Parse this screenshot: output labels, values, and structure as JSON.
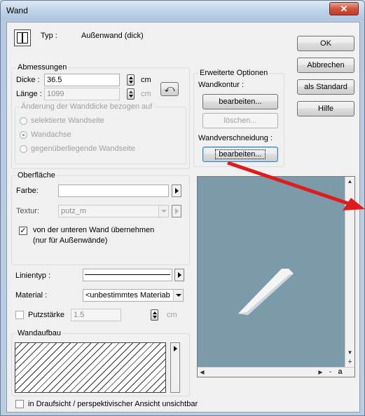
{
  "window": {
    "title": "Wand",
    "close_symbol": "✕"
  },
  "typ": {
    "label": "Typ :",
    "value": "Außenwand (dick)"
  },
  "buttons": {
    "ok": "OK",
    "abbrechen": "Abbrechen",
    "als_standard": "als Standard",
    "hilfe": "Hilfe"
  },
  "abmessungen": {
    "legend": "Abmessungen",
    "dicke_label": "Dicke :",
    "dicke_value": "36.5",
    "dicke_unit": "cm",
    "laenge_label": "Länge :",
    "laenge_value": "1099",
    "laenge_unit": "cm",
    "subgroup_legend": "Änderung der Wanddicke bezogen auf",
    "radio_options": [
      {
        "label": "selektierte Wandseite",
        "checked": false
      },
      {
        "label": "Wandachse",
        "checked": true
      },
      {
        "label": "gegenüberliegende Wandseite",
        "checked": false
      }
    ]
  },
  "erweiterte_optionen": {
    "legend": "Erweiterte Optionen",
    "wandkontur_label": "Wandkontur :",
    "bearbeiten_1": "bearbeiten...",
    "loeschen": "löschen...",
    "wandverschneidung_label": "Wandverschneidung :",
    "bearbeiten_2": "bearbeiten..."
  },
  "oberflaeche": {
    "legend": "Oberfläche",
    "farbe_label": "Farbe:",
    "textur_label": "Textur:",
    "textur_value": "putz_m",
    "checkbox_label_line1": "von der unteren Wand übernehmen",
    "checkbox_label_line2": "(nur für Außenwände)",
    "checkbox_checked": true
  },
  "linientyp": {
    "label": "Linientyp :"
  },
  "material": {
    "label": "Material :",
    "value": "<unbestimmtes Materiab"
  },
  "putzstaerke": {
    "label": "Putzstärke",
    "value": "1.5",
    "unit": "cm"
  },
  "wandaufbau": {
    "legend": "Wandaufbau"
  },
  "bottom_checkbox": {
    "label": "in Draufsicht / perspektivischer Ansicht unsichtbar",
    "checked": false
  },
  "preview_scroll": {
    "plus": "+",
    "minus": "-",
    "a": "a"
  },
  "colors": {
    "preview_bg": "#7b9bab",
    "annotation_arrow": "#e01b1b"
  }
}
